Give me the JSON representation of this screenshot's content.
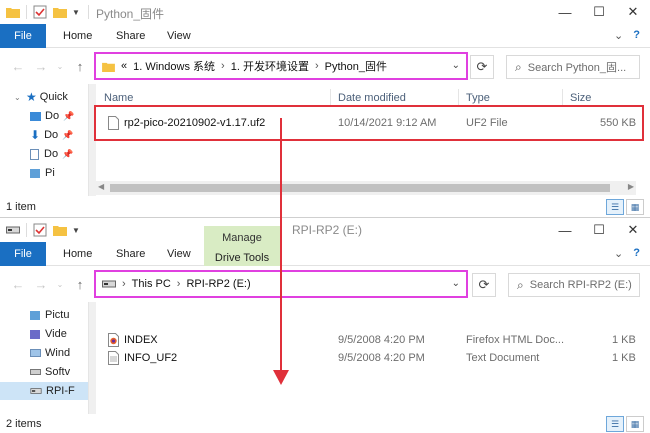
{
  "top_window": {
    "title": "Python_固件",
    "ribbon_tabs": [
      "File",
      "Home",
      "Share",
      "View"
    ],
    "address_prefix": "«",
    "breadcrumb": [
      "1. Windows 系统",
      "1. 开发环境设置",
      "Python_固件"
    ],
    "search_placeholder": "Search Python_固...",
    "nav_items": [
      "Quick",
      "Do",
      "Do",
      "Do",
      "Pi"
    ],
    "columns": [
      "Name",
      "Date modified",
      "Type",
      "Size"
    ],
    "files": [
      {
        "name": "rp2-pico-20210902-v1.17.uf2",
        "date": "10/14/2021 9:12 AM",
        "type": "UF2 File",
        "size": "550 KB"
      }
    ],
    "status": "1 item"
  },
  "bottom_window": {
    "manage_label": "Manage",
    "title": "RPI-RP2 (E:)",
    "ribbon_tabs": [
      "File",
      "Home",
      "Share",
      "View",
      "Drive Tools"
    ],
    "breadcrumb": [
      "This PC",
      "RPI-RP2 (E:)"
    ],
    "search_placeholder": "Search RPI-RP2 (E:)",
    "nav_items": [
      "Pictu",
      "Vide",
      "Wind",
      "Softv",
      "RPI-F"
    ],
    "files": [
      {
        "name": "INDEX",
        "date": "9/5/2008 4:20 PM",
        "type": "Firefox HTML Doc...",
        "size": "1 KB"
      },
      {
        "name": "INFO_UF2",
        "date": "9/5/2008 4:20 PM",
        "type": "Text Document",
        "size": "1 KB"
      }
    ],
    "status": "2 items"
  },
  "colors": {
    "file_tab": "#1a6fc2",
    "address_highlight": "#e040e0",
    "file_highlight": "#e0303a",
    "drag_arrow": "#e0303a",
    "manage_tab_bg": "#d9ecc4",
    "folder": "#f5c242",
    "column_header_text": "#4c607a"
  },
  "icons": {
    "folder": "folder-icon",
    "check": "properties-check-icon",
    "pin": "pin-icon",
    "drive": "usb-drive-icon",
    "back": "back-arrow-icon",
    "forward": "forward-arrow-icon",
    "up": "up-arrow-icon",
    "refresh": "refresh-icon",
    "search": "search-icon"
  }
}
